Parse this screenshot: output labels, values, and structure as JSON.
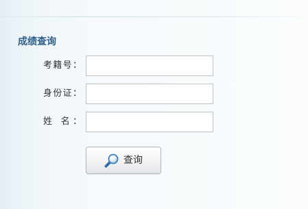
{
  "form": {
    "title": "成绩查询",
    "fields": [
      {
        "label": "考籍号：",
        "value": ""
      },
      {
        "label": "身份证：",
        "value": ""
      },
      {
        "label": "姓  名：",
        "value": ""
      }
    ],
    "submit_label": "查询"
  },
  "icons": {
    "submit": "magnifier-icon"
  },
  "colors": {
    "title": "#2f5f86",
    "background": "#f6fafc",
    "input_border": "#b9c3c9"
  }
}
